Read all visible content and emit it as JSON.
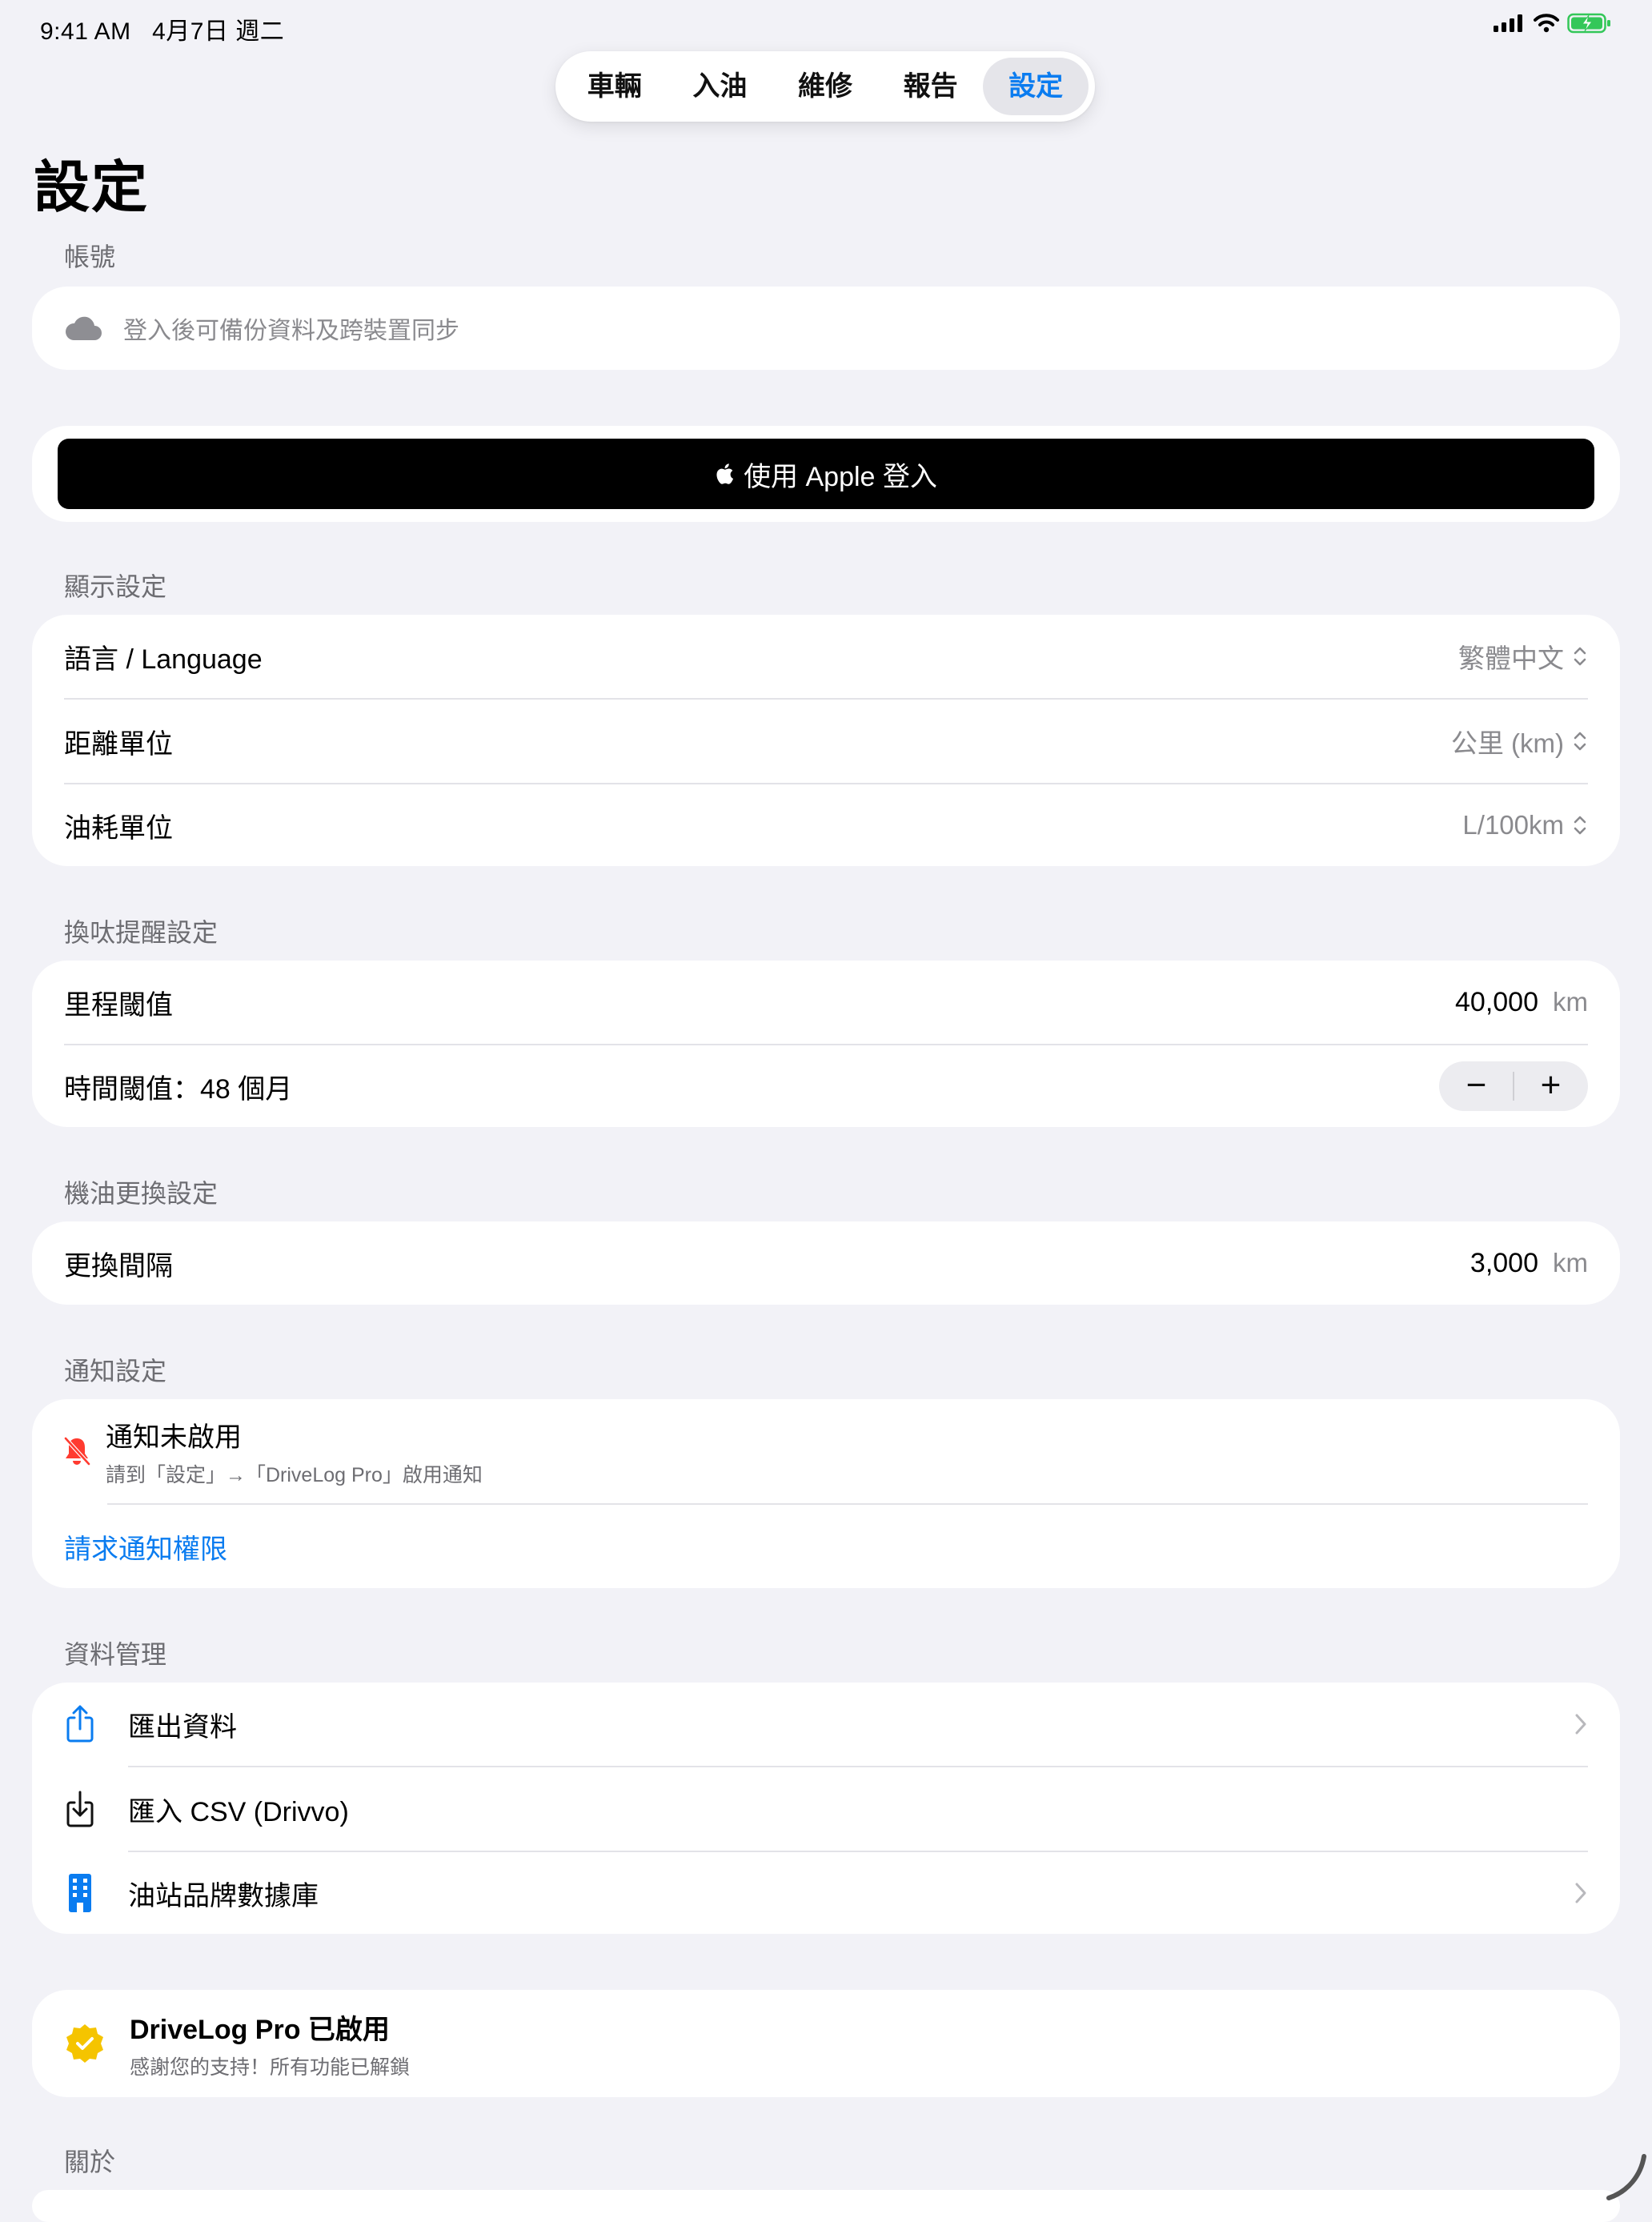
{
  "status_bar": {
    "time": "9:41 AM",
    "date": "4月7日 週二"
  },
  "tabs": [
    {
      "label": "車輛"
    },
    {
      "label": "入油"
    },
    {
      "label": "維修"
    },
    {
      "label": "報告"
    },
    {
      "label": "設定",
      "active": true
    }
  ],
  "page_title": "設定",
  "account": {
    "header": "帳號",
    "info": "登入後可備份資料及跨裝置同步",
    "apple_signin": "使用 Apple 登入"
  },
  "display": {
    "header": "顯示設定",
    "rows": [
      {
        "label": "語言 / Language",
        "value": "繁體中文"
      },
      {
        "label": "距離單位",
        "value": "公里 (km)"
      },
      {
        "label": "油耗單位",
        "value": "L/100km"
      }
    ]
  },
  "tire": {
    "header": "換呔提醒設定",
    "mileage_label": "里程閾值",
    "mileage_value": "40,000",
    "mileage_unit": "km",
    "time_label": "時間閾值：48 個月",
    "minus": "−",
    "plus": "+"
  },
  "oil": {
    "header": "機油更換設定",
    "interval_label": "更換間隔",
    "interval_value": "3,000",
    "interval_unit": "km"
  },
  "notification": {
    "header": "通知設定",
    "title": "通知未啟用",
    "subtitle": "請到「設定」→「DriveLog Pro」啟用通知",
    "request": "請求通知權限"
  },
  "data_mgmt": {
    "header": "資料管理",
    "rows": [
      {
        "label": "匯出資料",
        "icon": "share-icon"
      },
      {
        "label": "匯入 CSV (Drivvo)",
        "icon": "import-icon"
      },
      {
        "label": "油站品牌數據庫",
        "icon": "building-icon"
      }
    ]
  },
  "pro": {
    "title": "DriveLog Pro 已啟用",
    "subtitle": "感謝您的支持！所有功能已解鎖"
  },
  "about": {
    "header": "關於"
  },
  "colors": {
    "accent": "#0a7cf0",
    "background": "#f2f2f7",
    "alert_red": "#ff3b30",
    "badge_yellow": "#f5c400"
  }
}
